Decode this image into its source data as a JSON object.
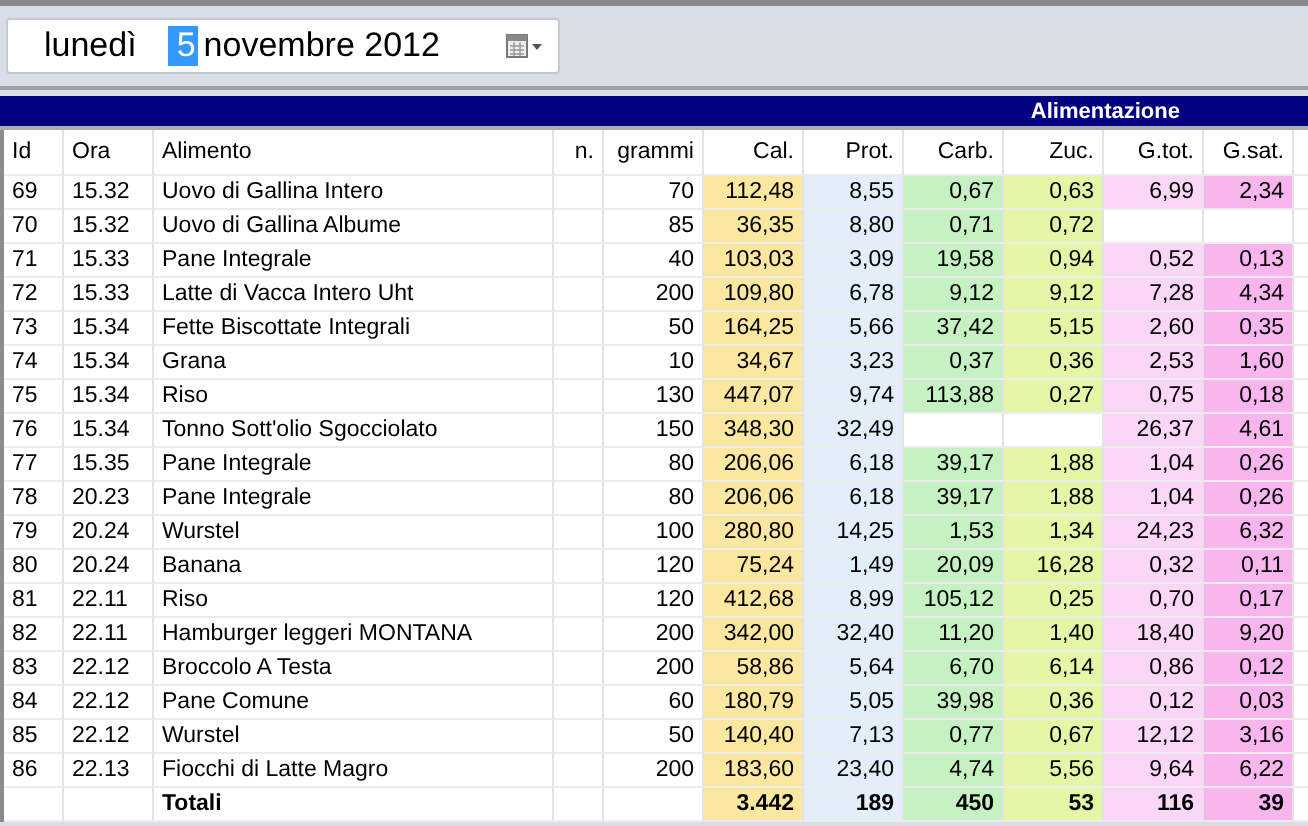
{
  "date_picker": {
    "weekday": "lunedì",
    "day": "5",
    "day_selected": true,
    "month_year": "novembre 2012"
  },
  "section_title": "Alimentazione",
  "columns": [
    {
      "label": "Id"
    },
    {
      "label": "Ora"
    },
    {
      "label": "Alimento"
    },
    {
      "label": "n."
    },
    {
      "label": "grammi"
    },
    {
      "label": "Cal.",
      "color": "#fce7a1"
    },
    {
      "label": "Prot.",
      "color": "#e2effa"
    },
    {
      "label": "Carb.",
      "color": "#c6f1c2"
    },
    {
      "label": "Zuc.",
      "color": "#e5f6a6"
    },
    {
      "label": "G.tot.",
      "color": "#fbd6f6"
    },
    {
      "label": "G.sat.",
      "color": "#f8b5ee"
    }
  ],
  "rows": [
    {
      "id": "69",
      "ora": "15.32",
      "alimento": "Uovo di Gallina Intero",
      "grammi": "70",
      "cal": "112,48",
      "prot": "8,55",
      "carb": "0,67",
      "zuc": "0,63",
      "g_tot": "6,99",
      "g_sat": "2,34"
    },
    {
      "id": "70",
      "ora": "15.32",
      "alimento": "Uovo di Gallina Albume",
      "grammi": "85",
      "cal": "36,35",
      "prot": "8,80",
      "carb": "0,71",
      "zuc": "0,72"
    },
    {
      "id": "71",
      "ora": "15.33",
      "alimento": "Pane Integrale",
      "grammi": "40",
      "cal": "103,03",
      "prot": "3,09",
      "carb": "19,58",
      "zuc": "0,94",
      "g_tot": "0,52",
      "g_sat": "0,13"
    },
    {
      "id": "72",
      "ora": "15.33",
      "alimento": "Latte di Vacca Intero Uht",
      "grammi": "200",
      "cal": "109,80",
      "prot": "6,78",
      "carb": "9,12",
      "zuc": "9,12",
      "g_tot": "7,28",
      "g_sat": "4,34"
    },
    {
      "id": "73",
      "ora": "15.34",
      "alimento": "Fette Biscottate Integrali",
      "grammi": "50",
      "cal": "164,25",
      "prot": "5,66",
      "carb": "37,42",
      "zuc": "5,15",
      "g_tot": "2,60",
      "g_sat": "0,35"
    },
    {
      "id": "74",
      "ora": "15.34",
      "alimento": "Grana",
      "grammi": "10",
      "cal": "34,67",
      "prot": "3,23",
      "carb": "0,37",
      "zuc": "0,36",
      "g_tot": "2,53",
      "g_sat": "1,60"
    },
    {
      "id": "75",
      "ora": "15.34",
      "alimento": "Riso",
      "grammi": "130",
      "cal": "447,07",
      "prot": "9,74",
      "carb": "113,88",
      "zuc": "0,27",
      "g_tot": "0,75",
      "g_sat": "0,18"
    },
    {
      "id": "76",
      "ora": "15.34",
      "alimento": "Tonno Sott'olio Sgocciolato",
      "grammi": "150",
      "cal": "348,30",
      "prot": "32,49",
      "g_tot": "26,37",
      "g_sat": "4,61"
    },
    {
      "id": "77",
      "ora": "15.35",
      "alimento": "Pane Integrale",
      "grammi": "80",
      "cal": "206,06",
      "prot": "6,18",
      "carb": "39,17",
      "zuc": "1,88",
      "g_tot": "1,04",
      "g_sat": "0,26"
    },
    {
      "id": "78",
      "ora": "20.23",
      "alimento": "Pane Integrale",
      "grammi": "80",
      "cal": "206,06",
      "prot": "6,18",
      "carb": "39,17",
      "zuc": "1,88",
      "g_tot": "1,04",
      "g_sat": "0,26"
    },
    {
      "id": "79",
      "ora": "20.24",
      "alimento": "Wurstel",
      "grammi": "100",
      "cal": "280,80",
      "prot": "14,25",
      "carb": "1,53",
      "zuc": "1,34",
      "g_tot": "24,23",
      "g_sat": "6,32"
    },
    {
      "id": "80",
      "ora": "20.24",
      "alimento": "Banana",
      "grammi": "120",
      "cal": "75,24",
      "prot": "1,49",
      "carb": "20,09",
      "zuc": "16,28",
      "g_tot": "0,32",
      "g_sat": "0,11"
    },
    {
      "id": "81",
      "ora": "22.11",
      "alimento": "Riso",
      "grammi": "120",
      "cal": "412,68",
      "prot": "8,99",
      "carb": "105,12",
      "zuc": "0,25",
      "g_tot": "0,70",
      "g_sat": "0,17"
    },
    {
      "id": "82",
      "ora": "22.11",
      "alimento": "Hamburger leggeri MONTANA",
      "grammi": "200",
      "cal": "342,00",
      "prot": "32,40",
      "carb": "11,20",
      "zuc": "1,40",
      "g_tot": "18,40",
      "g_sat": "9,20"
    },
    {
      "id": "83",
      "ora": "22.12",
      "alimento": "Broccolo A Testa",
      "grammi": "200",
      "cal": "58,86",
      "prot": "5,64",
      "carb": "6,70",
      "zuc": "6,14",
      "g_tot": "0,86",
      "g_sat": "0,12"
    },
    {
      "id": "84",
      "ora": "22.12",
      "alimento": "Pane Comune",
      "grammi": "60",
      "cal": "180,79",
      "prot": "5,05",
      "carb": "39,98",
      "zuc": "0,36",
      "g_tot": "0,12",
      "g_sat": "0,03"
    },
    {
      "id": "85",
      "ora": "22.12",
      "alimento": "Wurstel",
      "grammi": "50",
      "cal": "140,40",
      "prot": "7,13",
      "carb": "0,77",
      "zuc": "0,67",
      "g_tot": "12,12",
      "g_sat": "3,16"
    },
    {
      "id": "86",
      "ora": "22.13",
      "alimento": "Fiocchi di Latte Magro",
      "grammi": "200",
      "cal": "183,60",
      "prot": "23,40",
      "carb": "4,74",
      "zuc": "5,56",
      "g_tot": "9,64",
      "g_sat": "6,22"
    }
  ],
  "totals": {
    "alimento": "Totali",
    "cal": "3.442",
    "prot": "189",
    "carb": "450",
    "zuc": "53",
    "g_tot": "116",
    "g_sat": "39"
  }
}
